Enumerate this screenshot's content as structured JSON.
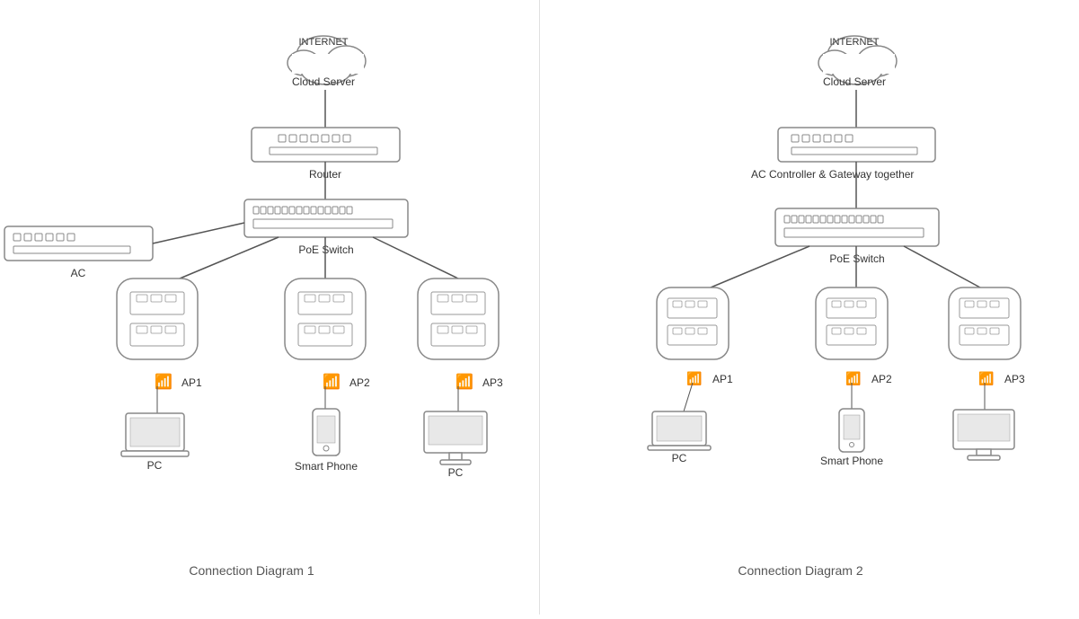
{
  "diagram1": {
    "caption": "Connection Diagram 1",
    "cloud_label_line1": "INTERNET",
    "cloud_label_line2": "Cloud Server",
    "router_label": "Router",
    "poe_switch_label": "PoE Switch",
    "ac_label": "AC",
    "ap1_label": "AP1",
    "ap2_label": "AP2",
    "ap3_label": "AP3",
    "pc1_label": "PC",
    "pc2_label": "PC",
    "phone_label": "Smart Phone"
  },
  "diagram2": {
    "caption": "Connection Diagram 2",
    "cloud_label_line1": "INTERNET",
    "cloud_label_line2": "Cloud Server",
    "gateway_label": "AC Controller & Gateway together",
    "poe_switch_label": "PoE Switch",
    "ap1_label": "AP1",
    "ap2_label": "AP2",
    "ap3_label": "AP3",
    "pc_label": "PC",
    "phone_label": "Smart Phone",
    "monitor_label": ""
  }
}
